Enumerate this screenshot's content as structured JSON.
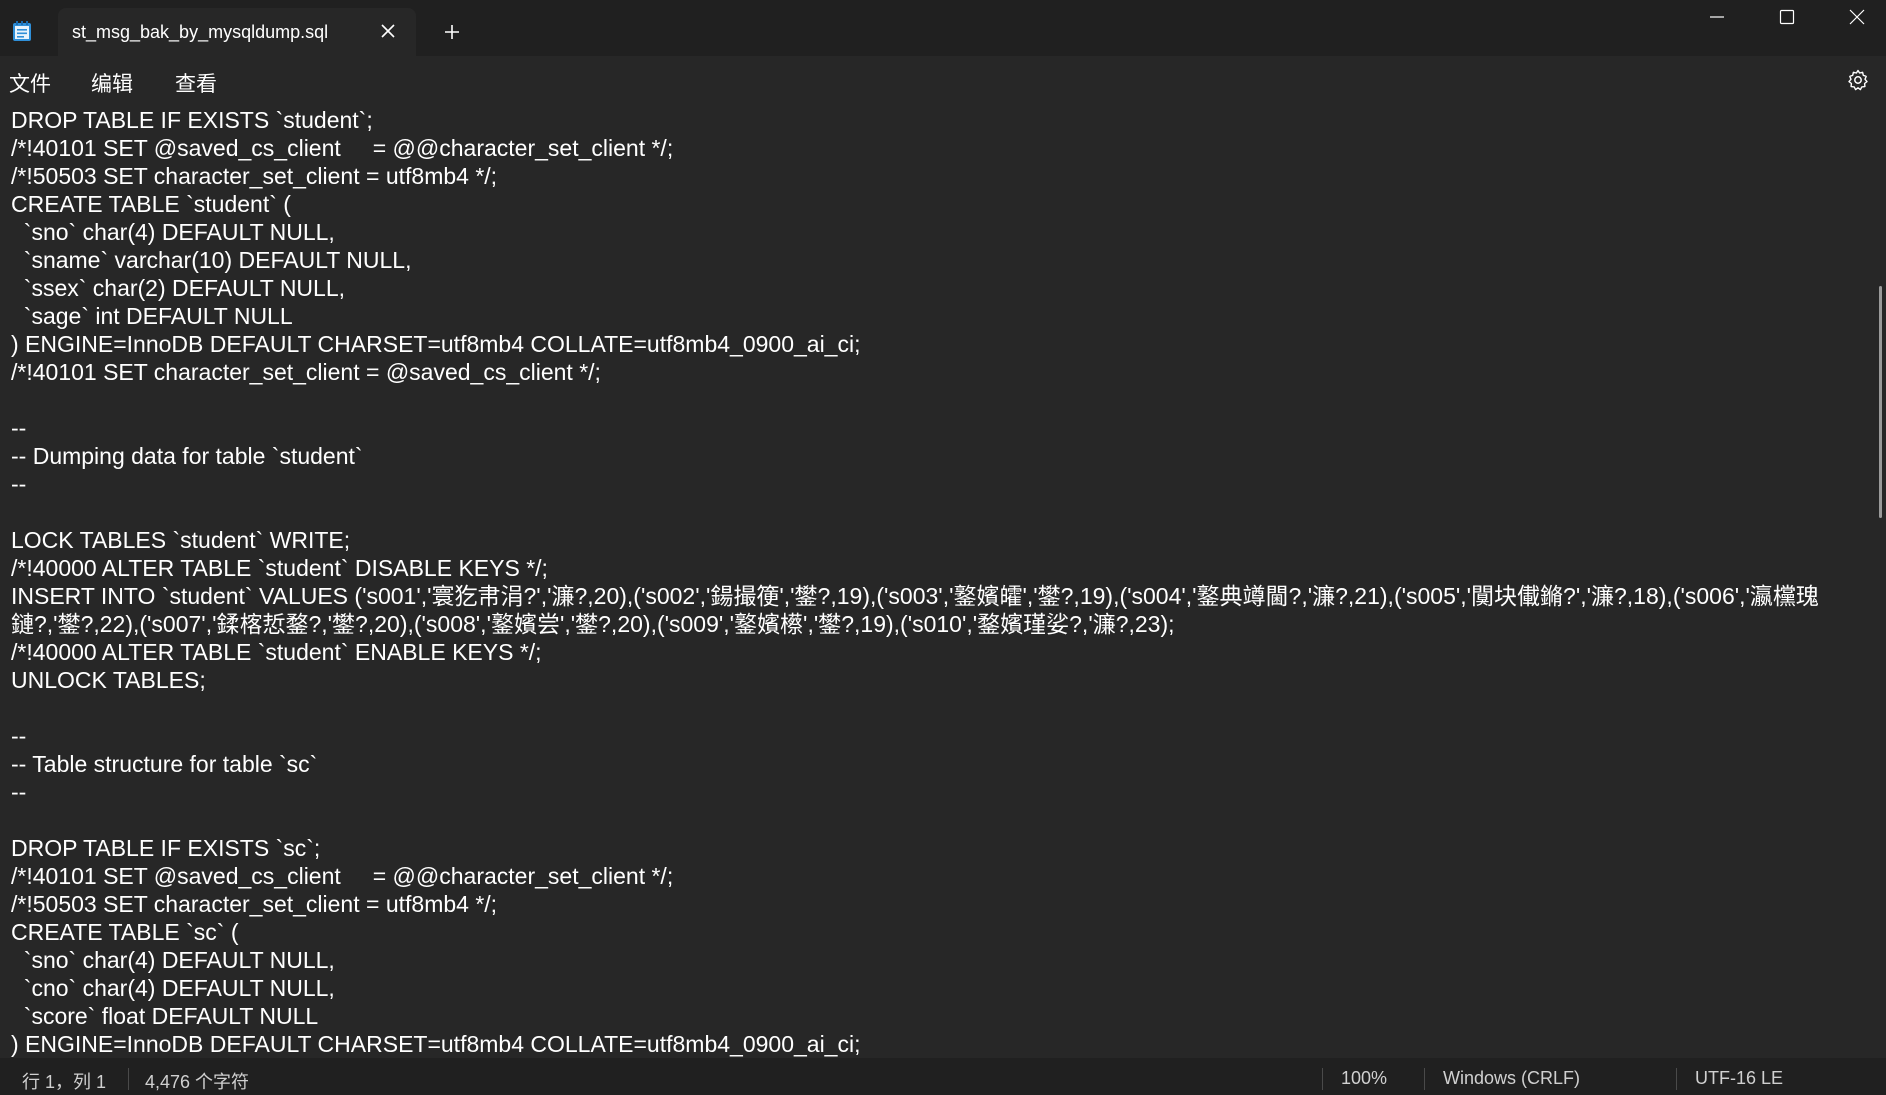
{
  "tab": {
    "title": "st_msg_bak_by_mysqldump.sql"
  },
  "menu": {
    "file": "文件",
    "edit": "编辑",
    "view": "查看"
  },
  "editor": {
    "lines": [
      "DROP TABLE IF EXISTS `student`;",
      "/*!40101 SET @saved_cs_client     = @@character_set_client */;",
      "/*!50503 SET character_set_client = utf8mb4 */;",
      "CREATE TABLE `student` (",
      "  `sno` char(4) DEFAULT NULL,",
      "  `sname` varchar(10) DEFAULT NULL,",
      "  `ssex` char(2) DEFAULT NULL,",
      "  `sage` int DEFAULT NULL",
      ") ENGINE=InnoDB DEFAULT CHARSET=utf8mb4 COLLATE=utf8mb4_0900_ai_ci;",
      "/*!40101 SET character_set_client = @saved_cs_client */;",
      "",
      "--",
      "-- Dumping data for table `student`",
      "--",
      "",
      "LOCK TABLES `student` WRITE;",
      "/*!40000 ALTER TABLE `student` DISABLE KEYS */;",
      "INSERT INTO `student` VALUES ('s001','寰犵帇涓?','濂?,20),('s002','鍚撮箯','鐢?,19),('s003','鐜嬪皬','鐢?,19),('s004','鐜典竴閫?,'濂?,21),('s005','闃块儎鏅?','濂?,18),('s006','瀛欓瑰",
      "鏈?,'鐢?,22),('s007','鍒楁悊鍪?,'鐢?,20),('s008','鐜嬪尝','鐢?,20),('s009','鐜嬪櫒','鐢?,19),('s010','鍪嬪瑾娑?,'濂?,23);",
      "/*!40000 ALTER TABLE `student` ENABLE KEYS */;",
      "UNLOCK TABLES;",
      "",
      "--",
      "-- Table structure for table `sc`",
      "--",
      "",
      "DROP TABLE IF EXISTS `sc`;",
      "/*!40101 SET @saved_cs_client     = @@character_set_client */;",
      "/*!50503 SET character_set_client = utf8mb4 */;",
      "CREATE TABLE `sc` (",
      "  `sno` char(4) DEFAULT NULL,",
      "  `cno` char(4) DEFAULT NULL,",
      "  `score` float DEFAULT NULL",
      ") ENGINE=InnoDB DEFAULT CHARSET=utf8mb4 COLLATE=utf8mb4_0900_ai_ci;"
    ]
  },
  "status": {
    "position": "行 1，列 1",
    "char_count": "4,476 个字符",
    "zoom": "100%",
    "line_ending": "Windows (CRLF)",
    "encoding": "UTF-16 LE"
  },
  "icons": {
    "app": "notepad-icon",
    "tab_close": "close-icon",
    "new_tab": "plus-icon",
    "minimize": "minimize-icon",
    "maximize": "maximize-icon",
    "close": "close-icon",
    "settings": "gear-icon"
  },
  "colors": {
    "background": "#272727",
    "titlebar": "#202020",
    "text": "#ffffff",
    "status_text": "#d0d0d0"
  }
}
